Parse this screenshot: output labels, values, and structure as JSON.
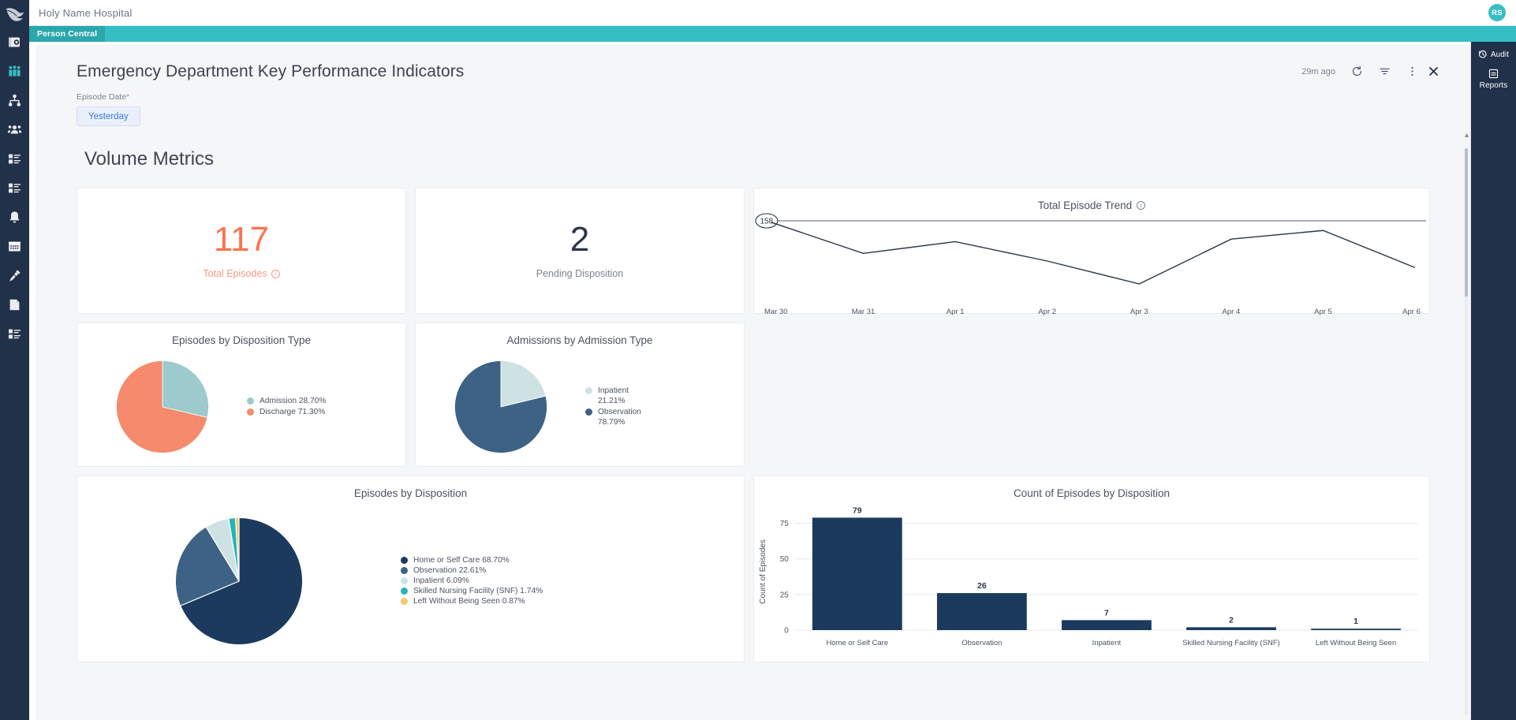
{
  "colors": {
    "rail_bg": "#22314a",
    "teal": "#35bfc4",
    "teal_tab": "#2aa7ad",
    "accent_orange": "#fb7350",
    "navy": "#1b3a5e",
    "steel": "#3d6285",
    "pale_blue": "#cfe2e3",
    "teal_slice": "#25b3b8",
    "yellow": "#f3c96a",
    "salmon": "#f58a6c",
    "soft_teal": "#9ccacd",
    "link_blue": "#3b78d8"
  },
  "topbar": {
    "title": "Holy Name Hospital",
    "avatar_initials": "RS",
    "logo_icon": "bird-logo-icon"
  },
  "tabstrip": {
    "active_tab": "Person Central"
  },
  "sidebar": {
    "items": [
      {
        "name": "sidebar-item-chart-review",
        "icon": "chart-review-icon",
        "label": "Chart Review",
        "active": false
      },
      {
        "name": "sidebar-item-population",
        "icon": "people-group-icon",
        "label": "Population",
        "active": true
      },
      {
        "name": "sidebar-item-hierarchy",
        "icon": "org-hierarchy-icon",
        "label": "Hierarchy",
        "active": false
      },
      {
        "name": "sidebar-item-care-team",
        "icon": "care-team-icon",
        "label": "Care Team",
        "active": false
      },
      {
        "name": "sidebar-item-worklist",
        "icon": "worklist-icon",
        "label": "Worklist",
        "active": false
      },
      {
        "name": "sidebar-item-tasks",
        "icon": "task-list-icon",
        "label": "Tasks",
        "active": false
      },
      {
        "name": "sidebar-item-alerts",
        "icon": "bell-icon",
        "label": "Alerts",
        "active": false
      },
      {
        "name": "sidebar-item-schedule",
        "icon": "calendar-icon",
        "label": "Schedule",
        "active": false
      },
      {
        "name": "sidebar-item-immunizations",
        "icon": "syringe-icon",
        "label": "Immunizations",
        "active": false
      },
      {
        "name": "sidebar-item-documents",
        "icon": "document-icon",
        "label": "Documents",
        "active": false
      },
      {
        "name": "sidebar-item-reports",
        "icon": "report-list-icon",
        "label": "Reports",
        "active": false
      }
    ]
  },
  "dashboard": {
    "title": "Emergency Department Key Performance Indicators",
    "stale_text": "29m ago",
    "tools": [
      {
        "name": "refresh-button",
        "icon": "refresh-icon"
      },
      {
        "name": "filter-button",
        "icon": "filter-icon"
      },
      {
        "name": "more-options-button",
        "icon": "kebab-menu-icon"
      },
      {
        "name": "close-button",
        "icon": "close-icon"
      }
    ],
    "filter": {
      "label": "Episode Date",
      "required_mark": "*",
      "chip_value": "Yesterday"
    },
    "section_title": "Volume Metrics"
  },
  "kpis": [
    {
      "name": "kpi-total-episodes",
      "value": "117",
      "label": "Total Episodes",
      "color": "#fb7350",
      "has_info": true
    },
    {
      "name": "kpi-pending-disposition",
      "value": "2",
      "label": "Pending Disposition",
      "color": "#2a3647",
      "has_info": false
    }
  ],
  "right_panel": {
    "items": [
      {
        "name": "audit-button",
        "label": "Audit",
        "icon": "history-clock-icon",
        "layout": "inline"
      },
      {
        "name": "reports-button",
        "label": "Reports",
        "icon": "report-icon",
        "layout": "stacked"
      }
    ]
  },
  "chart_data": [
    {
      "id": "total-episode-trend",
      "type": "line",
      "title": "Total Episode Trend",
      "has_info_icon": true,
      "x": [
        "Mar 30",
        "Mar 31",
        "Apr 1",
        "Apr 2",
        "Apr 3",
        "Apr 4",
        "Apr 5",
        "Apr 6"
      ],
      "values": [
        155,
        94,
        117,
        79,
        34,
        122,
        139,
        66
      ],
      "xlabel": "",
      "ylabel": "",
      "ylim": [
        0,
        158
      ],
      "reference_line": {
        "value": 158,
        "label": "158"
      },
      "grid": false,
      "legend": "none",
      "line_color": "#2a3647"
    },
    {
      "id": "episodes-by-disposition-type",
      "type": "pie",
      "title": "Episodes by Disposition Type",
      "labels": [
        "Admission",
        "Discharge"
      ],
      "values": [
        28.7,
        71.3
      ],
      "value_suffix": "%",
      "legend_entries": [
        "Admission 28.70%",
        "Discharge 71.30%"
      ],
      "colors": [
        "#9ccacd",
        "#f58a6c"
      ],
      "legend": "right"
    },
    {
      "id": "admissions-by-admission-type",
      "type": "pie",
      "title": "Admissions by Admission Type",
      "labels": [
        "Inpatient",
        "Observation"
      ],
      "values": [
        21.21,
        78.79
      ],
      "value_suffix": "%",
      "legend_entries": [
        "Inpatient",
        "21.21%",
        "Observation",
        "78.79%"
      ],
      "colors": [
        "#cfe2e3",
        "#3d6285"
      ],
      "legend": "right"
    },
    {
      "id": "episodes-by-disposition",
      "type": "pie",
      "title": "Episodes by Disposition",
      "labels": [
        "Home or Self Care",
        "Observation",
        "Inpatient",
        "Skilled Nursing Facility (SNF)",
        "Left Without Being Seen"
      ],
      "values": [
        68.7,
        22.61,
        6.09,
        1.74,
        0.87
      ],
      "value_suffix": "%",
      "legend_entries": [
        "Home or Self Care 68.70%",
        "Observation 22.61%",
        "Inpatient 6.09%",
        "Skilled Nursing Facility (SNF) 1.74%",
        "Left Without Being Seen 0.87%"
      ],
      "colors": [
        "#1b3a5e",
        "#3d6285",
        "#cfe2e3",
        "#25b3b8",
        "#f3c96a"
      ],
      "legend": "right"
    },
    {
      "id": "count-of-episodes-by-disposition",
      "type": "bar",
      "title": "Count of Episodes by Disposition",
      "categories": [
        "Home or Self Care",
        "Observation",
        "Inpatient",
        "Skilled Nursing Facility (SNF)",
        "Left Without Being Seen"
      ],
      "values": [
        79,
        26,
        7,
        2,
        1
      ],
      "xlabel": "",
      "ylabel": "Count of Episodes",
      "yticks": [
        0,
        25,
        50,
        75
      ],
      "ylim": [
        0,
        82
      ],
      "grid": true,
      "legend": "none",
      "bar_color": "#1b3a5e",
      "data_labels": true
    }
  ]
}
